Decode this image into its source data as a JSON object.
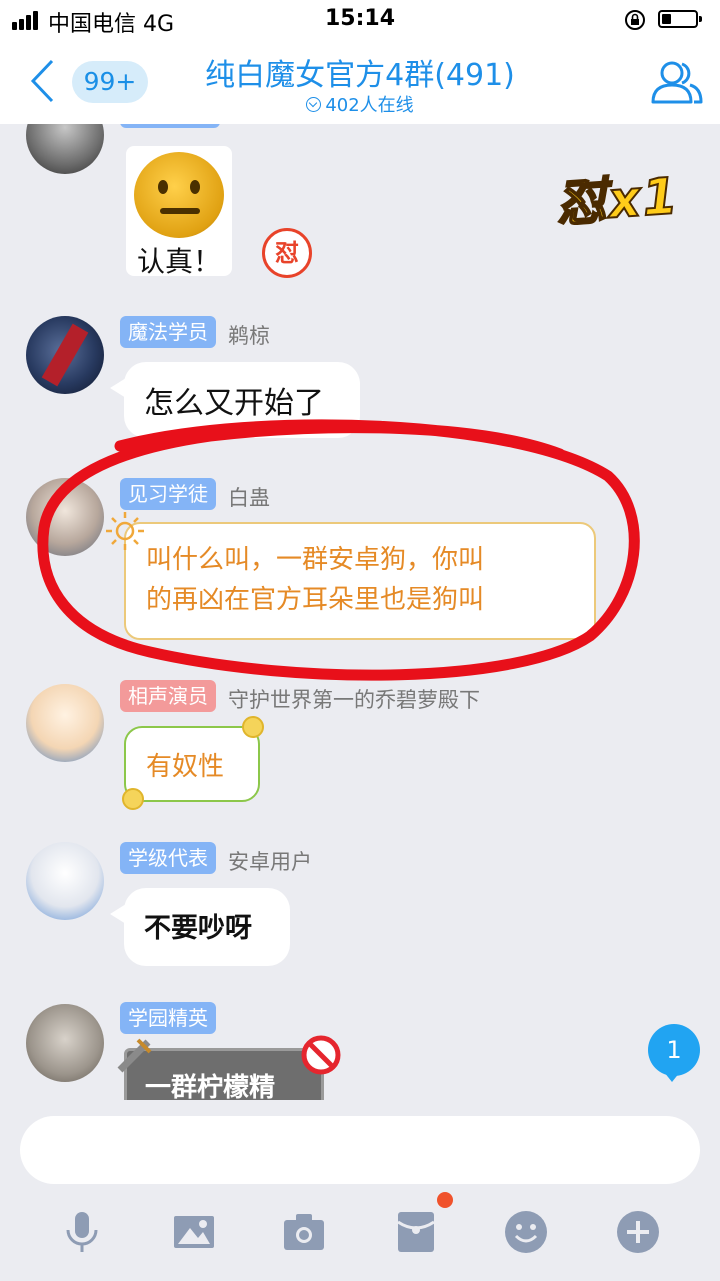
{
  "status_bar": {
    "carrier": "中国电信  4G",
    "time": "15:14"
  },
  "nav": {
    "unread_count": "99+",
    "title": "纯白魔女官方4群(491)",
    "online": "402人在线"
  },
  "sticker_messages": {
    "serious_caption": "认真！",
    "emblem_char": "怼",
    "combo": "怼x1"
  },
  "messages": [
    {
      "title_badge": "魔法学员",
      "badge_color": "#84b4f6",
      "nickname": "鹈椋",
      "text": "怎么又开始了"
    },
    {
      "title_badge": "见习学徒",
      "badge_color": "#84b4f6",
      "nickname": "白蛊",
      "text_line1": "叫什么叫，一群安卓狗，你叫",
      "text_line2": "的再凶在官方耳朵里也是狗叫"
    },
    {
      "title_badge": "相声演员",
      "badge_color": "#f39a9a",
      "nickname": "守护世界第一的乔碧萝殿下",
      "text": "有奴性"
    },
    {
      "title_badge": "学级代表",
      "badge_color": "#84b4f6",
      "nickname": "安卓用户",
      "text": "不要吵呀"
    },
    {
      "title_badge": "学园精英",
      "badge_color": "#84b4f6",
      "nickname": "",
      "text": "一群柠檬精"
    }
  ],
  "new_message_count": "1",
  "input": {
    "placeholder": ""
  },
  "toolbar": {
    "icons": [
      "microphone-icon",
      "image-icon",
      "camera-icon",
      "red-packet-icon",
      "emoji-icon",
      "plus-icon"
    ]
  },
  "colors": {
    "accent": "#1e8fe8",
    "annotation_circle": "#e8101a",
    "input_bar_bg": "#ebecf1"
  }
}
